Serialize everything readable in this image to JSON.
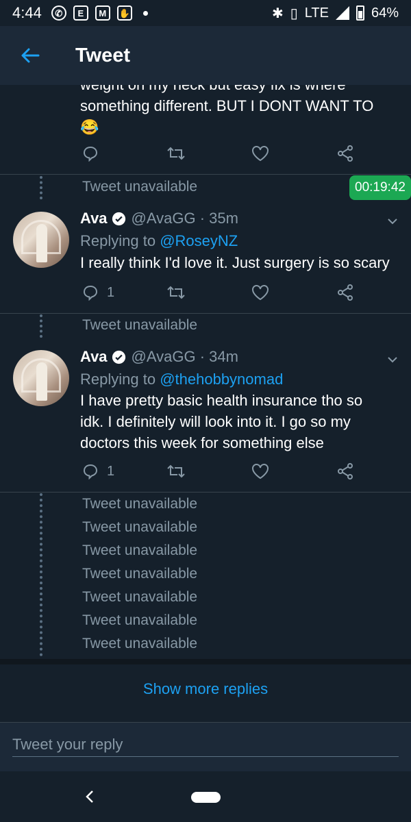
{
  "status_bar": {
    "time": "4:44",
    "network": "LTE",
    "battery": "64%",
    "icons": [
      "whatsapp-icon",
      "e-icon",
      "mail-icon",
      "hand-icon",
      "dot-icon",
      "bluetooth-icon",
      "vibrate-icon",
      "signal-icon",
      "battery-icon"
    ]
  },
  "header": {
    "title": "Tweet"
  },
  "top_tweet": {
    "text_partial": "weight on my neck but easy fix is where",
    "text": "something different. BUT I DONT WANT TO 😂"
  },
  "timer": "00:19:42",
  "unavailable_label": "Tweet unavailable",
  "tweets": [
    {
      "name": "Ava",
      "meta": "@AvaGG · 35m",
      "replying_prefix": "Replying to",
      "replying_handle": "@RoseyNZ",
      "body": "I really think I'd love it. Just surgery is so scary",
      "reply_count": "1"
    },
    {
      "name": "Ava",
      "meta": "@AvaGG · 34m",
      "replying_prefix": "Replying to",
      "replying_handle": "@thehobbynomad",
      "body": "I have pretty basic health insurance tho so idk. I definitely will look into it. I go so my doctors this week for something else",
      "reply_count": "1"
    }
  ],
  "unavailable_list": [
    "Tweet unavailable",
    "Tweet unavailable",
    "Tweet unavailable",
    "Tweet unavailable",
    "Tweet unavailable",
    "Tweet unavailable",
    "Tweet unavailable"
  ],
  "show_more": "Show more replies",
  "reply_bar": {
    "placeholder": "Tweet your reply"
  },
  "colors": {
    "background": "#15202b",
    "bar": "#1c2938",
    "accent": "#1da1f2",
    "muted": "#8899a6",
    "timer": "#1ca853"
  }
}
